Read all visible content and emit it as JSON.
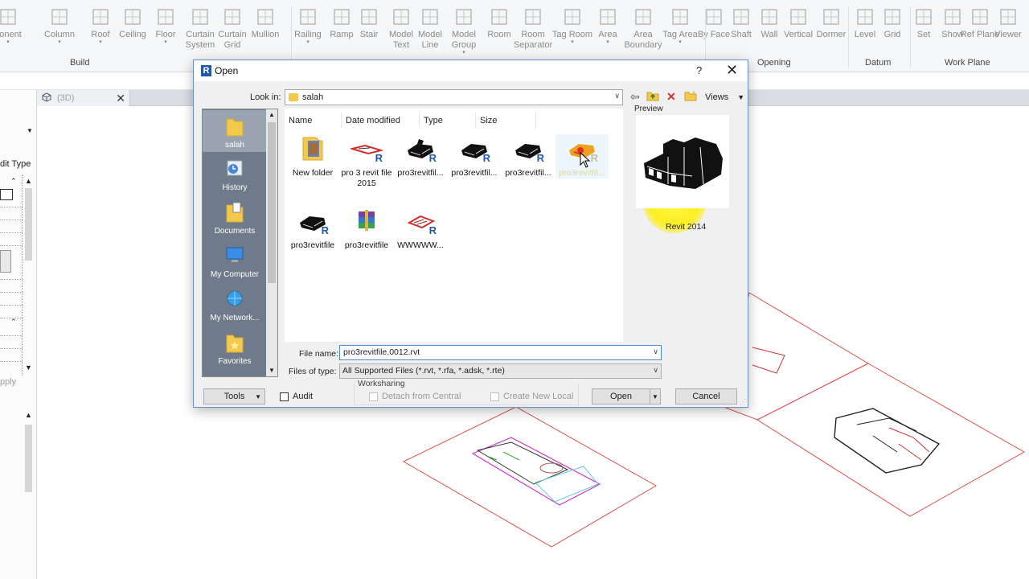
{
  "ribbon": {
    "tools": [
      {
        "label": "ponent",
        "dropdown": true
      },
      {
        "label": "Column",
        "dropdown": true
      },
      {
        "label": "Roof",
        "dropdown": true
      },
      {
        "label": "Ceiling",
        "dropdown": false
      },
      {
        "label": "Floor",
        "dropdown": true
      },
      {
        "label": "Curtain System",
        "dropdown": false
      },
      {
        "label": "Curtain Grid",
        "dropdown": false
      },
      {
        "label": "Mullion",
        "dropdown": false
      },
      {
        "label": "Railing",
        "dropdown": true
      },
      {
        "label": "Ramp",
        "dropdown": false
      },
      {
        "label": "Stair",
        "dropdown": false
      },
      {
        "label": "Model Text",
        "dropdown": false
      },
      {
        "label": "Model Line",
        "dropdown": false
      },
      {
        "label": "Model Group",
        "dropdown": true
      },
      {
        "label": "Room",
        "dropdown": false
      },
      {
        "label": "Room Separator",
        "dropdown": false
      },
      {
        "label": "Tag Room",
        "dropdown": true
      },
      {
        "label": "Area",
        "dropdown": true
      },
      {
        "label": "Area Boundary",
        "dropdown": false
      },
      {
        "label": "Tag Area",
        "dropdown": true
      },
      {
        "label": "By Face",
        "dropdown": false
      },
      {
        "label": "Shaft",
        "dropdown": false
      },
      {
        "label": "Wall",
        "dropdown": false
      },
      {
        "label": "Vertical",
        "dropdown": false
      },
      {
        "label": "Dormer",
        "dropdown": false
      },
      {
        "label": "Level",
        "dropdown": false
      },
      {
        "label": "Grid",
        "dropdown": false
      },
      {
        "label": "Set",
        "dropdown": false
      },
      {
        "label": "Show",
        "dropdown": false
      },
      {
        "label": "Ref Plane",
        "dropdown": false
      },
      {
        "label": "Viewer",
        "dropdown": false
      }
    ],
    "groups": {
      "build": "Build",
      "opening": "Opening",
      "datum": "Datum",
      "work_plane": "Work Plane"
    }
  },
  "view_tab": {
    "label": "(3D)",
    "close": "✕"
  },
  "left_panel": {
    "edit_type": "dit Type",
    "apply": "pply"
  },
  "dialog": {
    "title": "Open",
    "help": "?",
    "close": "✕",
    "look_in_label": "Look in:",
    "look_in_value": "salah",
    "views_label": "Views",
    "places": [
      {
        "label": "salah",
        "selected": true
      },
      {
        "label": "History",
        "selected": false
      },
      {
        "label": "Documents",
        "selected": false
      },
      {
        "label": "My Computer",
        "selected": false
      },
      {
        "label": "My Network...",
        "selected": false
      },
      {
        "label": "Favorites",
        "selected": false
      }
    ],
    "columns": [
      "Name",
      "Date modified",
      "Type",
      "Size"
    ],
    "files": [
      {
        "name": "New folder",
        "kind": "folder"
      },
      {
        "name": "pro 3 revit file 2015",
        "kind": "revit-plan"
      },
      {
        "name": "pro3revitfil...",
        "kind": "revit-3d"
      },
      {
        "name": "pro3revitfil...",
        "kind": "revit-3d"
      },
      {
        "name": "pro3revitfil...",
        "kind": "revit-3d"
      },
      {
        "name": "pro3revitfil...",
        "kind": "revit-3d-selected"
      },
      {
        "name": "pro3revitfile",
        "kind": "revit-3d"
      },
      {
        "name": "pro3revitfile",
        "kind": "winrar"
      },
      {
        "name": "WWWWW...",
        "kind": "revit-plan"
      }
    ],
    "preview_label": "Preview",
    "preview_caption": "Revit 2014",
    "file_name_label": "File name:",
    "file_name_value": "pro3revitfile.0012.rvt",
    "file_type_label": "Files of type:",
    "file_type_value": "All Supported Files  (*.rvt, *.rfa, *.adsk, *.rte)",
    "tools_label": "Tools",
    "audit_label": "Audit",
    "worksharing_label": "Worksharing",
    "detach_label": "Detach from Central",
    "create_local_label": "Create New Local",
    "open_label": "Open",
    "cancel_label": "Cancel"
  },
  "colors": {
    "accent": "#1f5aa6",
    "plan_line": "#e05050",
    "highlight": "#fff200"
  }
}
